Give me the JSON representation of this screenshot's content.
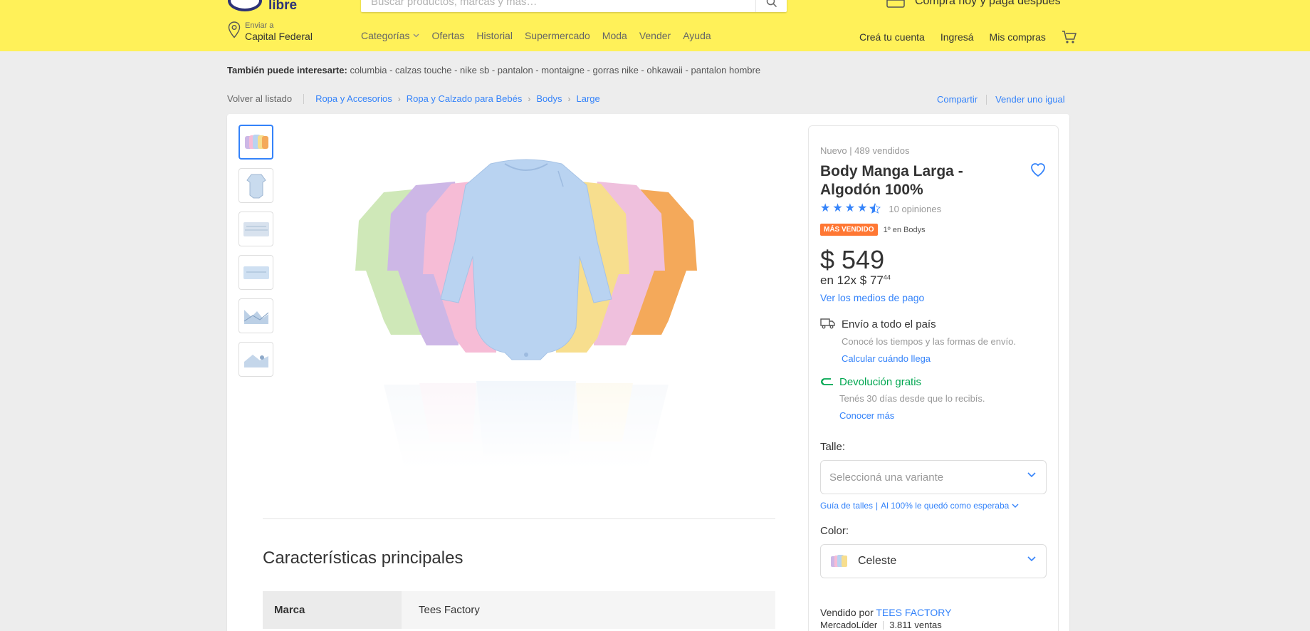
{
  "header": {
    "logo_text": "libre",
    "search_placeholder": "Buscar productos, marcas y más…",
    "promo_text": "Comprá hoy y pagá después",
    "location_line1": "Enviar a",
    "location_line2": "Capital Federal",
    "nav": [
      {
        "label": "Categorías"
      },
      {
        "label": "Ofertas"
      },
      {
        "label": "Historial"
      },
      {
        "label": "Supermercado"
      },
      {
        "label": "Moda"
      },
      {
        "label": "Vender"
      },
      {
        "label": "Ayuda"
      }
    ],
    "account": {
      "create": "Creá tu cuenta",
      "login": "Ingresá",
      "purchases": "Mis compras"
    }
  },
  "suggestions": {
    "label": "También puede interesarte:",
    "items": "columbia - calzas touche - nike sb - pantalon - montaigne - gorras nike - ohkawaii - pantalon hombre"
  },
  "breadcrumb": {
    "back": "Volver al listado",
    "items": [
      "Ropa y Accesorios",
      "Ropa y Calzado para Bebés",
      "Bodys",
      "Large"
    ],
    "share": "Compartir",
    "sell_same": "Vender uno igual"
  },
  "product": {
    "condition": "Nuevo  |  489 vendidos",
    "title": "Body Manga Larga - Algodón 100%",
    "rating": 4.5,
    "reviews": "10 opiniones",
    "badge": "MÁS VENDIDO",
    "rank": "1º en Bodys",
    "price": "$ 549",
    "installments_prefix": "en 12x $ 77",
    "installments_cents": "44",
    "payment_link": "Ver los medios de pago",
    "shipping_title": "Envío a todo el país",
    "shipping_sub": "Conocé los tiempos y las formas de envío.",
    "shipping_link": "Calcular cuándo llega",
    "return_title": "Devolución gratis",
    "return_sub": "Tenés 30 días desde que lo recibís.",
    "return_link": "Conocer más",
    "size_label": "Talle:",
    "size_placeholder": "Seleccioná una variante",
    "size_guide": "Guía de talles",
    "size_fit": "Al 100% le quedó como esperaba",
    "color_label": "Color:",
    "color_value": "Celeste",
    "seller_prefix": "Vendido por",
    "seller_name": "TEES FACTORY",
    "seller_level": "MercadoLíder",
    "seller_sales": "3.811 ventas"
  },
  "features": {
    "title": "Características principales",
    "rows": [
      {
        "key": "Marca",
        "value": "Tees Factory"
      }
    ]
  },
  "colors": {
    "header_bg": "#fff159",
    "link": "#3483fa",
    "green": "#00a650",
    "badge": "#ff7733",
    "onesies": [
      "#cfe8b8",
      "#cdb7e6",
      "#f6bcd6",
      "#b9d3f1",
      "#f7de8e",
      "#efc0dd",
      "#f4a95a"
    ]
  }
}
